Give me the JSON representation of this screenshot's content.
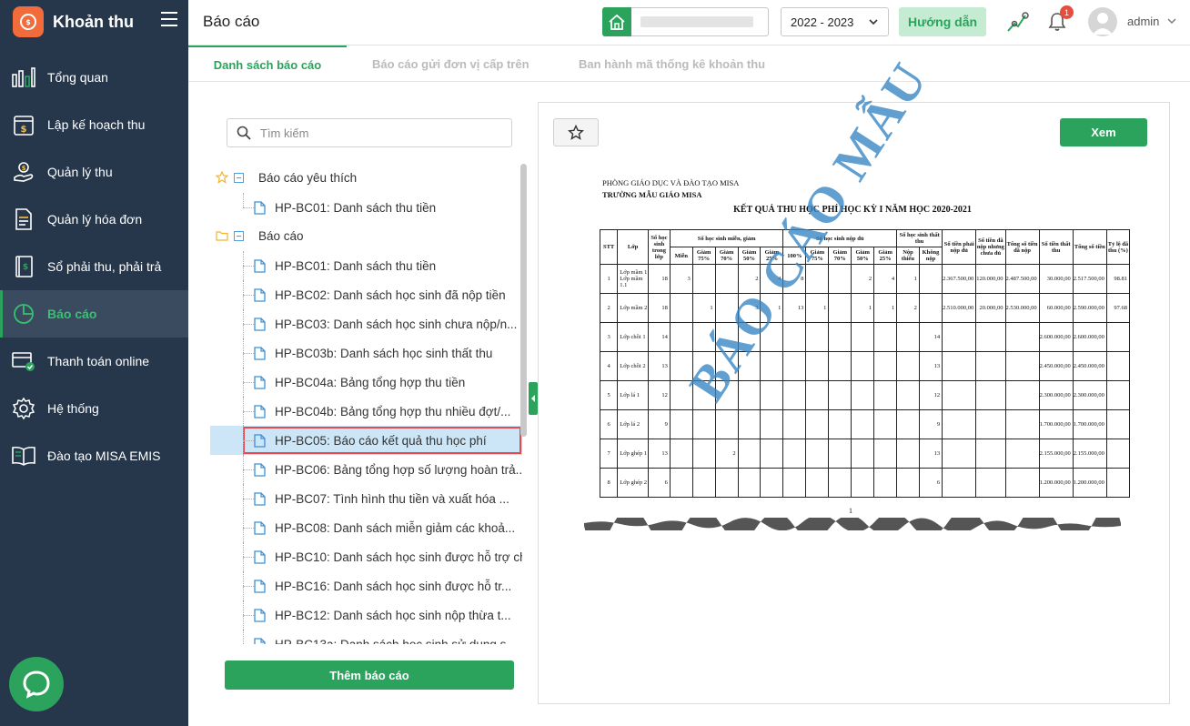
{
  "app": {
    "title": "Khoản thu"
  },
  "sidebar": {
    "items": [
      {
        "label": "Tổng quan",
        "icon": "bar-chart-icon"
      },
      {
        "label": "Lập kế hoạch thu",
        "icon": "calendar-dollar-icon"
      },
      {
        "label": "Quản lý thu",
        "icon": "hand-coin-icon"
      },
      {
        "label": "Quản lý hóa đơn",
        "icon": "invoice-icon"
      },
      {
        "label": "Sổ phải thu, phải trả",
        "icon": "ledger-icon"
      },
      {
        "label": "Báo cáo",
        "icon": "pie-chart-icon"
      },
      {
        "label": "Thanh toán online",
        "icon": "online-payment-icon"
      },
      {
        "label": "Hệ thống",
        "icon": "gear-icon"
      },
      {
        "label": "Đào tạo MISA EMIS",
        "icon": "book-icon"
      }
    ],
    "active_index": 5
  },
  "header": {
    "page_title": "Báo cáo",
    "school_year": "2022 - 2023",
    "guide_label": "Hướng dẫn",
    "notification_count": "1",
    "user_name": "admin"
  },
  "tabs": [
    {
      "label": "Danh sách báo cáo",
      "active": true
    },
    {
      "label": "Báo cáo gửi đơn vị cấp trên",
      "active": false
    },
    {
      "label": "Ban hành mã thống kê khoản thu",
      "active": false
    }
  ],
  "search": {
    "placeholder": "Tìm kiếm"
  },
  "tree": {
    "favorites": {
      "label": "Báo cáo yêu thích",
      "items": [
        "HP-BC01: Danh sách thu tiền"
      ]
    },
    "reports": {
      "label": "Báo cáo",
      "items": [
        "HP-BC01: Danh sách thu tiền",
        "HP-BC02: Danh sách học sinh đã nộp tiền",
        "HP-BC03: Danh sách học sinh chưa nộp/n...",
        "HP-BC03b: Danh sách học sinh thất thu",
        "HP-BC04a: Bảng tổng hợp thu tiền",
        "HP-BC04b: Bảng tổng hợp thu nhiều đợt/...",
        "HP-BC05: Báo cáo kết quả thu học phí",
        "HP-BC06: Bảng tổng hợp số lượng hoàn trả...",
        "HP-BC07: Tình hình thu tiền và xuất hóa ...",
        "HP-BC08: Danh sách miễn giảm các khoả...",
        "HP-BC10: Danh sách học sinh được hỗ trợ ch",
        "HP-BC16: Danh sách học sinh được hỗ tr...",
        "HP-BC12: Danh sách học sinh nộp thừa t...",
        "HP-BC13a: Danh sách học sinh sử dụng s"
      ],
      "selected_index": 6
    }
  },
  "add_report_label": "Thêm báo cáo",
  "preview": {
    "view_label": "Xem",
    "org_line1": "PHÒNG GIÁO DỤC VÀ ĐÀO TẠO MISA",
    "org_line2": "TRƯỜNG MẪU GIÁO MISA",
    "title": "KẾT QUẢ THU HỌC PHÍ HỌC KỲ I NĂM HỌC 2020-2021",
    "watermark": "BÁO CÁO MẪU",
    "page_number": "1",
    "table": {
      "h_stt": "STT",
      "h_lop": "Lớp",
      "h_sohs": "Số học sinh trong lớp",
      "h_mien_group": "Số học sinh miễn, giảm",
      "h_nop_group": "Số học sinh nộp đủ",
      "h_that_group": "Số học sinh thất thu",
      "h_tien_phai": "Số tiền phải nộp đủ",
      "h_tien_no": "Số tiền đã nộp nhưng chưa đủ",
      "h_tong_da": "Tổng số tiền đã nộp",
      "h_that_thu": "Số tiền thất thu",
      "h_tong": "Tổng số tiền",
      "h_tyle": "Tỷ lệ đã thu (%)",
      "sub_mien": [
        "Miễn",
        "Giảm 75%",
        "Giảm 70%",
        "Giảm 50%",
        "Giảm 25%"
      ],
      "sub_nop": [
        "100%",
        "Giảm 75%",
        "Giảm 70%",
        "Giảm 50%",
        "Giảm 25%"
      ],
      "sub_that": [
        "Nộp thiếu",
        "Không nộp"
      ],
      "rows": [
        {
          "stt": "1",
          "lop": "Lớp mầm 1 Lớp mầm 1.1",
          "sohs": "18",
          "c": [
            "3",
            "",
            "",
            "2",
            "4",
            "8",
            "",
            "",
            "2",
            "4",
            "1",
            "",
            "2.367.500,00",
            "120.000,00",
            "2.487.500,00",
            "30.000,00",
            "2.517.500,00",
            "98.81"
          ]
        },
        {
          "stt": "2",
          "lop": "Lớp mầm 2",
          "sohs": "18",
          "c": [
            "",
            "1",
            "",
            "3",
            "1",
            "13",
            "1",
            "",
            "1",
            "1",
            "2",
            "",
            "2.510.000,00",
            "20.000,00",
            "2.530.000,00",
            "60.000,00",
            "2.590.000,00",
            "97.68"
          ]
        },
        {
          "stt": "3",
          "lop": "Lớp chồi 1",
          "sohs": "14",
          "c": [
            "",
            "",
            "",
            "",
            "",
            "",
            "",
            "",
            "",
            "",
            "",
            "14",
            "",
            "",
            "",
            "2.600.000,00",
            "2.600.000,00",
            ""
          ]
        },
        {
          "stt": "4",
          "lop": "Lớp chồi 2",
          "sohs": "13",
          "c": [
            "",
            "",
            "",
            "",
            "",
            "",
            "",
            "",
            "",
            "",
            "",
            "13",
            "",
            "",
            "",
            "2.450.000,00",
            "2.450.000,00",
            ""
          ]
        },
        {
          "stt": "5",
          "lop": "Lớp lá 1",
          "sohs": "12",
          "c": [
            "",
            "",
            "",
            "",
            "",
            "",
            "",
            "",
            "",
            "",
            "",
            "12",
            "",
            "",
            "",
            "2.300.000,00",
            "2.300.000,00",
            ""
          ]
        },
        {
          "stt": "6",
          "lop": "Lớp lá 2",
          "sohs": "9",
          "c": [
            "",
            "",
            "",
            "",
            "",
            "",
            "",
            "",
            "",
            "",
            "",
            "9",
            "",
            "",
            "",
            "1.700.000,00",
            "1.700.000,00",
            ""
          ]
        },
        {
          "stt": "7",
          "lop": "Lớp ghép 1",
          "sohs": "13",
          "c": [
            "",
            "",
            "2",
            "",
            "",
            "",
            "",
            "",
            "",
            "",
            "",
            "13",
            "",
            "",
            "",
            "2.155.000,00",
            "2.155.000,00",
            ""
          ]
        },
        {
          "stt": "8",
          "lop": "Lớp ghép 2",
          "sohs": "6",
          "c": [
            "",
            "",
            "",
            "",
            "",
            "",
            "",
            "",
            "",
            "",
            "",
            "6",
            "",
            "",
            "",
            "1.200.000,00",
            "1.200.000,00",
            ""
          ]
        }
      ]
    }
  },
  "colors": {
    "accent": "#2ba35d",
    "sidebar": "#27374b",
    "watermark": "#3484c4",
    "selection_border": "#e6494f"
  }
}
